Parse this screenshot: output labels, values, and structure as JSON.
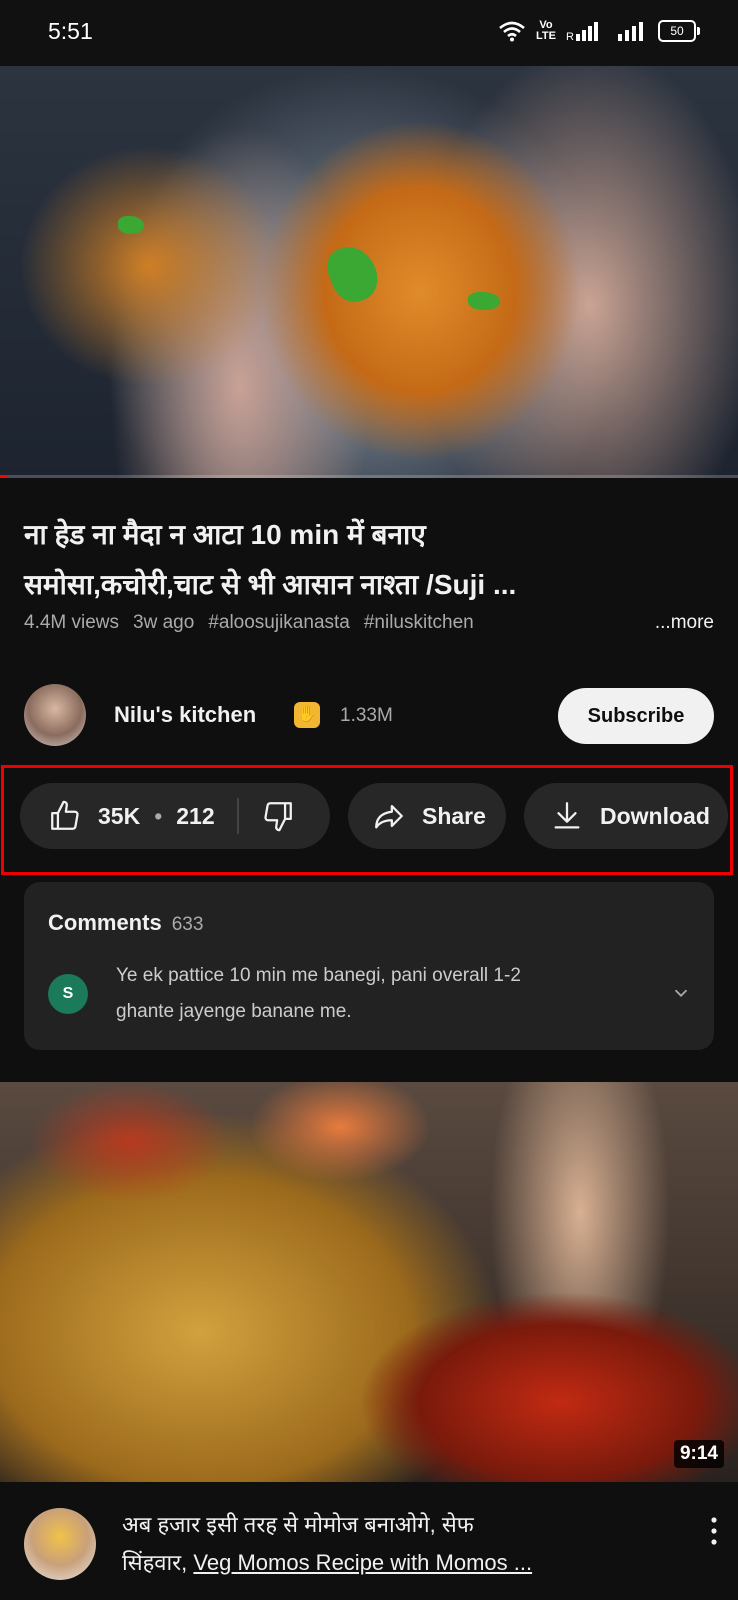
{
  "status_bar": {
    "time": "5:51",
    "volte": "Vo LTE",
    "roaming": "R",
    "battery": "50",
    "icons": [
      "wifi-icon",
      "signal-icon",
      "signal-icon",
      "battery-icon"
    ]
  },
  "video": {
    "title_line1": "ना हेड ना मैदा न आटा 10 min में बनाए",
    "title_line2": "समोसा,कचोरी,चाट से भी आसान नाश्ता /Suji ...",
    "views": "4.4M views",
    "age": "3w ago",
    "hashtag1": "#aloosujikanasta",
    "hashtag2": "#niluskitchen",
    "more_label": "...more",
    "progress_fraction": 0.01
  },
  "channel": {
    "name": "Nilu's kitchen",
    "badge_icon": "clap-icon",
    "subscribers": "1.33M",
    "subscribe_label": "Subscribe"
  },
  "actions": {
    "likes": "35K",
    "dislike_count": "212",
    "share_label": "Share",
    "download_label": "Download",
    "icons": [
      "thumbs-up-icon",
      "thumbs-down-icon",
      "share-icon",
      "download-icon"
    ]
  },
  "comments": {
    "title": "Comments",
    "count": "633",
    "avatar_letter": "S",
    "top_comment_line1": "Ye ek pattice 10 min me banegi, pani overall 1-2",
    "top_comment_line2": "ghante jayenge banane me."
  },
  "next_video": {
    "duration": "9:14",
    "title_line1": "अब हजार इसी तरह से मोमोज बनाओगे, सेफ",
    "title_line2_prefix": "सिंहवार, ",
    "title_line2_link": "Veg Momos Recipe with Momos ..."
  },
  "colors": {
    "background": "#0f0f0f",
    "pill": "#272727",
    "highlight": "#e00000",
    "subscribe_bg": "#f1f1f1"
  }
}
